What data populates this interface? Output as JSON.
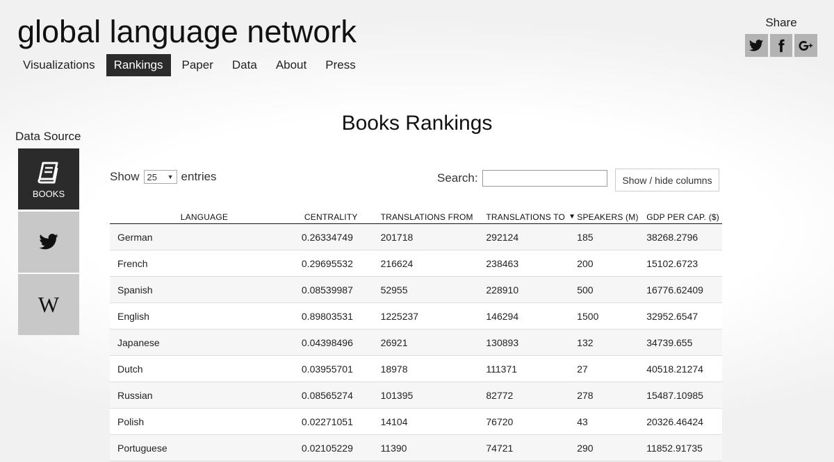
{
  "header": {
    "title": "global language network",
    "nav": [
      {
        "label": "Visualizations",
        "active": false
      },
      {
        "label": "Rankings",
        "active": true
      },
      {
        "label": "Paper",
        "active": false
      },
      {
        "label": "Data",
        "active": false
      },
      {
        "label": "About",
        "active": false
      },
      {
        "label": "Press",
        "active": false
      }
    ]
  },
  "share": {
    "label": "Share",
    "icons": [
      "twitter-icon",
      "facebook-icon",
      "google-plus-icon"
    ]
  },
  "data_source": {
    "label": "Data Source",
    "books_label": "BOOKS",
    "wiki_glyph": "W"
  },
  "page": {
    "heading": "Books Rankings"
  },
  "controls": {
    "show_label": "Show",
    "entries_value": "25",
    "entries_label": "entries",
    "search_label": "Search:",
    "search_value": "",
    "columns_button": "Show / hide columns"
  },
  "table": {
    "columns": [
      "LANGUAGE",
      "CENTRALITY",
      "TRANSLATIONS FROM",
      "TRANSLATIONS TO",
      "SPEAKERS (M)",
      "GDP PER CAP. ($)"
    ],
    "sorted_column": "TRANSLATIONS TO",
    "sort_direction": "descending",
    "rows": [
      [
        "German",
        "0.26334749",
        "201718",
        "292124",
        "185",
        "38268.2796"
      ],
      [
        "French",
        "0.29695532",
        "216624",
        "238463",
        "200",
        "15102.6723"
      ],
      [
        "Spanish",
        "0.08539987",
        "52955",
        "228910",
        "500",
        "16776.62409"
      ],
      [
        "English",
        "0.89803531",
        "1225237",
        "146294",
        "1500",
        "32952.6547"
      ],
      [
        "Japanese",
        "0.04398496",
        "26921",
        "130893",
        "132",
        "34739.655"
      ],
      [
        "Dutch",
        "0.03955701",
        "18978",
        "111371",
        "27",
        "40518.21274"
      ],
      [
        "Russian",
        "0.08565274",
        "101395",
        "82772",
        "278",
        "15487.10985"
      ],
      [
        "Polish",
        "0.02271051",
        "14104",
        "76720",
        "43",
        "20326.46424"
      ],
      [
        "Portuguese",
        "0.02105229",
        "11390",
        "74721",
        "290",
        "11852.91735"
      ]
    ]
  }
}
